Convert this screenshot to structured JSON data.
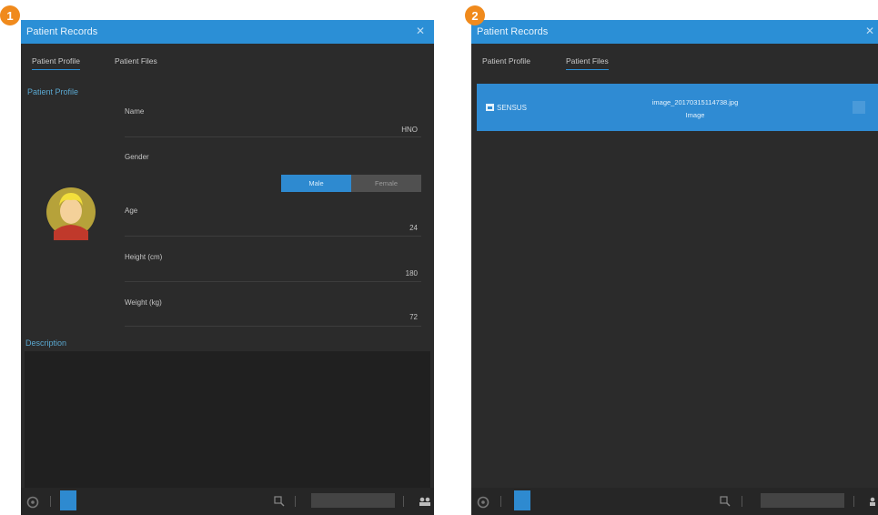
{
  "badges": [
    "1",
    "2"
  ],
  "window_title": "Patient Records",
  "tabs": [
    "Patient Profile",
    "Patient Files"
  ],
  "profile": {
    "section_title": "Patient Profile",
    "fields": {
      "name_label": "Name",
      "name_value": "HNO",
      "gender_label": "Gender",
      "gender_male": "Male",
      "gender_female": "Female",
      "age_label": "Age",
      "age_value": "24",
      "height_label": "Height (cm)",
      "height_value": "180",
      "weight_label": "Weight (kg)",
      "weight_value": "72"
    },
    "description_title": "Description"
  },
  "files": {
    "item": {
      "name": "SENSUS",
      "filename": "image_20170315114738.jpg",
      "type": "Image"
    }
  },
  "colors": {
    "titlebar": "#2b8fd6",
    "panel_bg": "#2b2b2b",
    "badge": "#f08a1c",
    "accent_text": "#5aa7cf"
  },
  "icons": [
    "close-icon",
    "gear-icon",
    "patient-icon",
    "zoom-icon",
    "layers-icon",
    "user-add-icon",
    "image-file-icon"
  ]
}
